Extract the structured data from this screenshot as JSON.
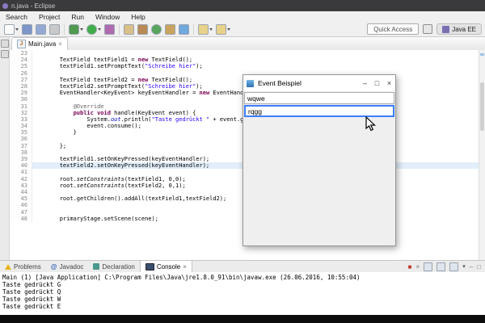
{
  "window": {
    "title": "n.java - Eclipse"
  },
  "menubar": {
    "items": [
      "Search",
      "Project",
      "Run",
      "Window",
      "Help"
    ]
  },
  "toolbar": {
    "buttons": [
      "new-wizard",
      "save",
      "save-all",
      "print",
      "debug",
      "run",
      "profile",
      "new-java-project",
      "new-package",
      "new-class",
      "new-jar",
      "search",
      "back",
      "forward"
    ],
    "dropdown_buttons": [
      "new-wizard",
      "debug",
      "run",
      "back",
      "forward"
    ],
    "quick_access_label": "Quick Access",
    "perspective_label": "Java EE"
  },
  "editor": {
    "tab_label": "Main.java",
    "lines": [
      {
        "n": "23",
        "seg": []
      },
      {
        "n": "24",
        "seg": [
          [
            "p",
            "        TextField textField1 = "
          ],
          [
            "k",
            "new"
          ],
          [
            "p",
            " TextField();"
          ]
        ]
      },
      {
        "n": "25",
        "seg": [
          [
            "p",
            "        textField1.setPromptText("
          ],
          [
            "s",
            "\"Schreibe hier\""
          ],
          [
            "p",
            ");"
          ]
        ]
      },
      {
        "n": "26",
        "seg": []
      },
      {
        "n": "27",
        "seg": [
          [
            "p",
            "        TextField textField2 = "
          ],
          [
            "k",
            "new"
          ],
          [
            "p",
            " TextField();"
          ]
        ]
      },
      {
        "n": "28",
        "seg": [
          [
            "p",
            "        textField2.setPromptText("
          ],
          [
            "s",
            "\"Schreibe hier\""
          ],
          [
            "p",
            ");"
          ]
        ]
      },
      {
        "n": "29",
        "seg": [
          [
            "p",
            "        EventHandler<KeyEvent> keyEventHandler = "
          ],
          [
            "k",
            "new"
          ],
          [
            "p",
            " EventHandler<KeyEvent>() {"
          ]
        ]
      },
      {
        "n": "30",
        "seg": []
      },
      {
        "n": "31",
        "seg": [
          [
            "a",
            "            @Override"
          ]
        ]
      },
      {
        "n": "32",
        "seg": [
          [
            "p",
            "            "
          ],
          [
            "k",
            "public"
          ],
          [
            "p",
            " "
          ],
          [
            "k",
            "void"
          ],
          [
            "p",
            " handle(KeyEvent event) {"
          ]
        ]
      },
      {
        "n": "33",
        "seg": [
          [
            "p",
            "                System."
          ],
          [
            "sf",
            "out"
          ],
          [
            "p",
            ".println("
          ],
          [
            "s",
            "\"Taste gedrückt \""
          ],
          [
            "p",
            " + event.getText());"
          ]
        ]
      },
      {
        "n": "34",
        "seg": [
          [
            "p",
            "                event.consume();"
          ]
        ]
      },
      {
        "n": "35",
        "seg": [
          [
            "p",
            "            }"
          ]
        ]
      },
      {
        "n": "36",
        "seg": []
      },
      {
        "n": "37",
        "seg": [
          [
            "p",
            "        };"
          ]
        ]
      },
      {
        "n": "38",
        "seg": []
      },
      {
        "n": "39",
        "seg": [
          [
            "p",
            "        textField1.setOnKeyPressed(keyEventHandler);"
          ]
        ]
      },
      {
        "n": "40",
        "h": true,
        "seg": [
          [
            "p",
            "        textField2.setOnKeyPressed(keyEventHandler);"
          ]
        ]
      },
      {
        "n": "41",
        "seg": []
      },
      {
        "n": "42",
        "seg": [
          [
            "p",
            "        root."
          ],
          [
            "sm",
            "setConstraints"
          ],
          [
            "p",
            "(textField1, 0,0);"
          ]
        ]
      },
      {
        "n": "43",
        "seg": [
          [
            "p",
            "        root."
          ],
          [
            "sm",
            "setConstraints"
          ],
          [
            "p",
            "(textField2, 0,1);"
          ]
        ]
      },
      {
        "n": "44",
        "seg": []
      },
      {
        "n": "45",
        "seg": [
          [
            "p",
            "        root.getChildren().addAll(textField1,textField2);"
          ]
        ]
      },
      {
        "n": "46",
        "seg": []
      },
      {
        "n": "47",
        "seg": []
      },
      {
        "n": "48",
        "seg": [
          [
            "p",
            "        primaryStage.setScene(scene);"
          ]
        ]
      }
    ]
  },
  "dialog": {
    "title": "Event Beispiel",
    "field1_value": "wqwe",
    "field2_value": "rqgg"
  },
  "console": {
    "tabs": [
      "Problems",
      "Javadoc",
      "Declaration",
      "Console"
    ],
    "active_tab": "Console",
    "header": "Main (1) [Java Application] C:\\Program Files\\Java\\jre1.8.0_91\\bin\\javaw.exe (26.06.2016, 10:55:04)",
    "lines": [
      "Taste gedrückt G",
      "Taste gedrückt Q",
      "Taste gedrückt W",
      "Taste gedrückt E"
    ]
  },
  "icons": {
    "java_file": "J",
    "close": "×",
    "minimize": "–",
    "maximize": "□",
    "dropdown": "▾",
    "stop": "■",
    "javadoc": "@"
  },
  "colors": {
    "keyword": "#7b0052",
    "string": "#2a00ff",
    "static_field": "#0000c0",
    "annotation": "#646464",
    "current_line": "#e2eefa",
    "focus_border": "#3d7eff",
    "titlebar": "#3a3a3c"
  }
}
